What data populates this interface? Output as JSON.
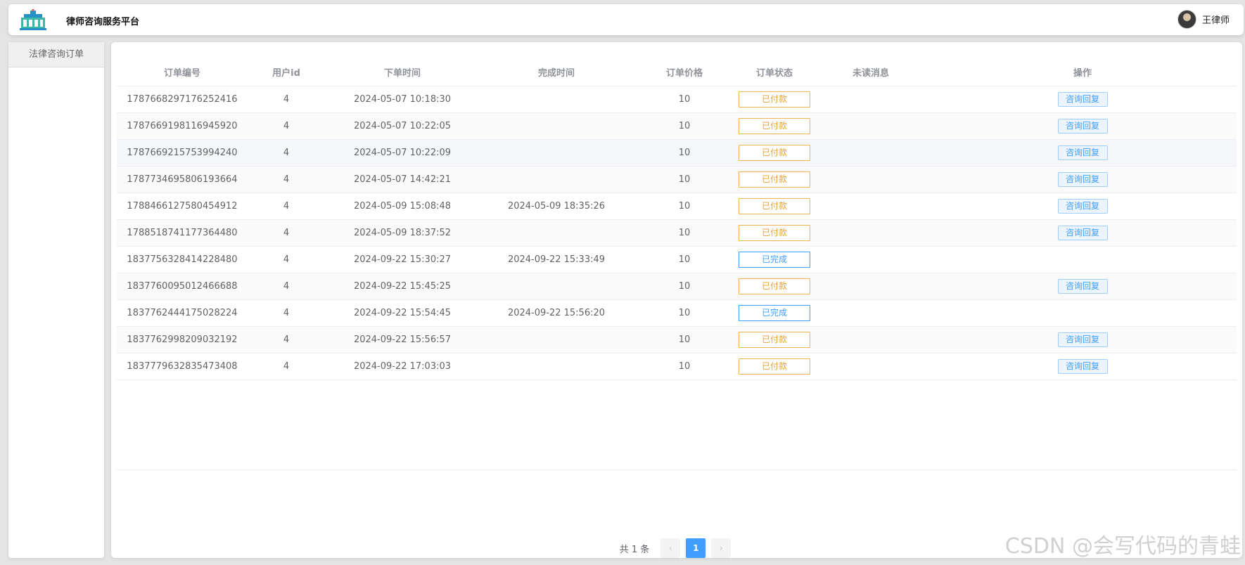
{
  "header": {
    "title": "律师咨询服务平台",
    "user_name": "王律师"
  },
  "sidebar": {
    "items": [
      {
        "label": "法律咨询订单"
      }
    ]
  },
  "table": {
    "columns": [
      "订单编号",
      "用户id",
      "下单时间",
      "完成时间",
      "订单价格",
      "订单状态",
      "未读消息",
      "操作"
    ],
    "reply_label": "咨询回复",
    "rows": [
      {
        "order_id": "1787668297176252416",
        "user_id": "4",
        "order_time": "2024-05-07 10:18:30",
        "finish_time": "",
        "price": "10",
        "status": "已付款",
        "unread": "",
        "has_reply": true
      },
      {
        "order_id": "1787669198116945920",
        "user_id": "4",
        "order_time": "2024-05-07 10:22:05",
        "finish_time": "",
        "price": "10",
        "status": "已付款",
        "unread": "",
        "has_reply": true
      },
      {
        "order_id": "1787669215753994240",
        "user_id": "4",
        "order_time": "2024-05-07 10:22:09",
        "finish_time": "",
        "price": "10",
        "status": "已付款",
        "unread": "",
        "has_reply": true
      },
      {
        "order_id": "1787734695806193664",
        "user_id": "4",
        "order_time": "2024-05-07 14:42:21",
        "finish_time": "",
        "price": "10",
        "status": "已付款",
        "unread": "",
        "has_reply": true
      },
      {
        "order_id": "1788466127580454912",
        "user_id": "4",
        "order_time": "2024-05-09 15:08:48",
        "finish_time": "2024-05-09 18:35:26",
        "price": "10",
        "status": "已付款",
        "unread": "",
        "has_reply": true
      },
      {
        "order_id": "1788518741177364480",
        "user_id": "4",
        "order_time": "2024-05-09 18:37:52",
        "finish_time": "",
        "price": "10",
        "status": "已付款",
        "unread": "",
        "has_reply": true
      },
      {
        "order_id": "1837756328414228480",
        "user_id": "4",
        "order_time": "2024-09-22 15:30:27",
        "finish_time": "2024-09-22 15:33:49",
        "price": "10",
        "status": "已完成",
        "unread": "",
        "has_reply": false
      },
      {
        "order_id": "1837760095012466688",
        "user_id": "4",
        "order_time": "2024-09-22 15:45:25",
        "finish_time": "",
        "price": "10",
        "status": "已付款",
        "unread": "",
        "has_reply": true
      },
      {
        "order_id": "1837762444175028224",
        "user_id": "4",
        "order_time": "2024-09-22 15:54:45",
        "finish_time": "2024-09-22 15:56:20",
        "price": "10",
        "status": "已完成",
        "unread": "",
        "has_reply": false
      },
      {
        "order_id": "1837762998209032192",
        "user_id": "4",
        "order_time": "2024-09-22 15:56:57",
        "finish_time": "",
        "price": "10",
        "status": "已付款",
        "unread": "",
        "has_reply": true
      },
      {
        "order_id": "1837779632835473408",
        "user_id": "4",
        "order_time": "2024-09-22 17:03:03",
        "finish_time": "",
        "price": "10",
        "status": "已付款",
        "unread": "",
        "has_reply": true
      }
    ]
  },
  "pagination": {
    "total_text": "共 1 条",
    "current_page": "1",
    "prev_icon": "‹",
    "next_icon": "›"
  },
  "watermark": "CSDN @会写代码的青蛙",
  "colors": {
    "primary": "#409eff",
    "paid": "#e6a23c",
    "done": "#409eff"
  }
}
